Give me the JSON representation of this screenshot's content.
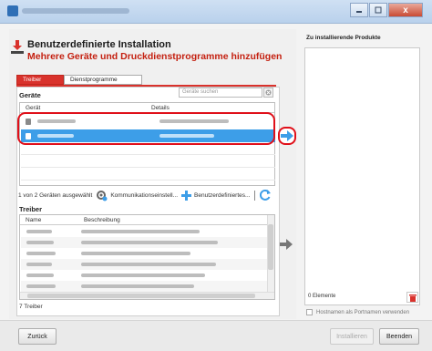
{
  "window": {
    "close_glyph": "x"
  },
  "header": {
    "title": "Benutzerdefinierte Installation",
    "subtitle": "Mehrere Geräte und Druckdienstprogramme hinzufügen",
    "icon": "install-icon"
  },
  "tabs": [
    {
      "label": "Treiber",
      "active": true
    },
    {
      "label": "Dienstprogramme",
      "active": false
    }
  ],
  "devices": {
    "section_label": "Geräte",
    "search_placeholder": "Geräte suchen",
    "columns": [
      "Gerät",
      "Details"
    ],
    "status": "1 von 2 Geräten ausgewählt"
  },
  "toolbar": {
    "comm_settings": "Kommunikationseinstell...",
    "custom_device": "Benutzerdefiniertes..."
  },
  "drivers": {
    "section_label": "Treiber",
    "columns": [
      "Name",
      "Beschreibung"
    ],
    "count": "7 Treiber"
  },
  "products": {
    "title": "Zu installierende Produkte",
    "count": "0 Elemente",
    "hostname_option": "Hostnamen als Portnamen verwenden"
  },
  "buttons": {
    "back": "Zurück",
    "install": "Installieren",
    "finish": "Beenden"
  },
  "colors": {
    "accent": "#d9322c",
    "selection": "#3d9ee8",
    "highlight": "#e0101a"
  }
}
